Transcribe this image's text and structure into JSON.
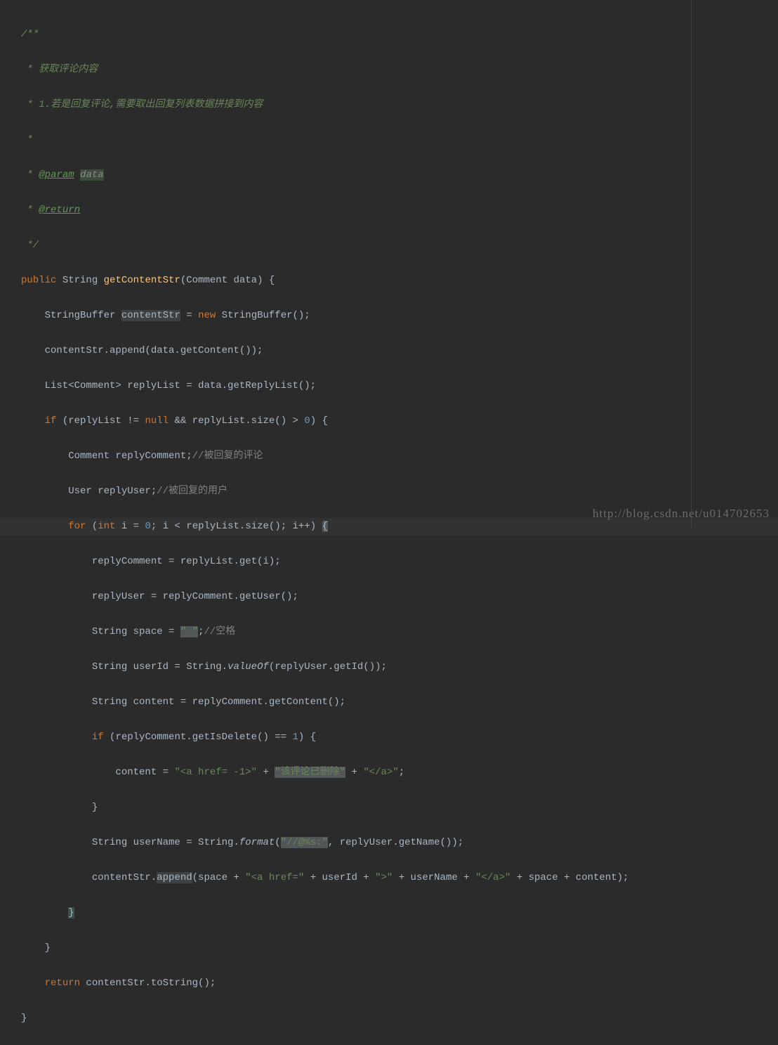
{
  "code": {
    "l1": "/**",
    "l2_pre": " * ",
    "l2_txt": "获取评论内容",
    "l3_pre": " * ",
    "l3_txt": "1.若是回复评论,需要取出回复列表数据拼接到内容",
    "l4": " *",
    "l5_pre": " * ",
    "l5_tag": "@param",
    "l5_sp": " ",
    "l5_param": "data",
    "l6_pre": " * ",
    "l6_tag": "@return",
    "l7": " */",
    "l8_kw1": "public",
    "l8_type": " String ",
    "l8_method": "getContentStr",
    "l8_rest": "(Comment data) {",
    "l9_pre": "    StringBuffer ",
    "l9_var": "contentStr",
    "l9_eq": " = ",
    "l9_new": "new",
    "l9_rest": " StringBuffer();",
    "l10": "    contentStr.append(data.getContent());",
    "l11": "    List<Comment> replyList = data.getReplyList();",
    "l12_pre": "    ",
    "l12_if": "if",
    "l12_mid1": " (replyList != ",
    "l12_null": "null",
    "l12_mid2": " && replyList.size() > ",
    "l12_num": "0",
    "l12_rest": ") {",
    "l13_pre": "        Comment replyComment;",
    "l13_cmt": "//被回复的评论",
    "l14_pre": "        User replyUser;",
    "l14_cmt": "//被回复的用户",
    "l15_pre": "        ",
    "l15_for": "for",
    "l15_mid1": " (",
    "l15_int": "int",
    "l15_mid2": " i = ",
    "l15_num": "0",
    "l15_mid3": "; i < replyList.size(); i++) ",
    "l15_brace": "{",
    "l16": "            replyComment = replyList.get(i);",
    "l17": "            replyUser = replyComment.getUser();",
    "l18_pre": "            String space = ",
    "l18_str": "\" \"",
    "l18_semi": ";",
    "l18_cmt": "//空格",
    "l19_pre": "            String userId = String.",
    "l19_method": "valueOf",
    "l19_rest": "(replyUser.getId());",
    "l20": "            String content = replyComment.getContent();",
    "l21_pre": "            ",
    "l21_if": "if",
    "l21_mid": " (replyComment.getIsDelete() == ",
    "l21_num": "1",
    "l21_rest": ") {",
    "l22_pre": "                content = ",
    "l22_s1": "\"<a href= -1>\"",
    "l22_p1": " + ",
    "l22_s2": "\"该评论已删除\"",
    "l22_p2": " + ",
    "l22_s3": "\"</a>\"",
    "l22_semi": ";",
    "l23": "            }",
    "l24_pre": "            String userName = String.",
    "l24_method": "format",
    "l24_op": "(",
    "l24_s1": "\"//@%s:\"",
    "l24_rest": ", replyUser.getName());",
    "l25_pre": "            contentStr.",
    "l25_method": "append",
    "l25_mid1": "(space + ",
    "l25_s1": "\"<a href=\"",
    "l25_mid2": " + userId + ",
    "l25_s2": "\">\"",
    "l25_mid3": " + userName + ",
    "l25_s3": "\"</a>\"",
    "l25_mid4": " + space + content);",
    "l26_pre": "        ",
    "l26_brace": "}",
    "l27": "    }",
    "l28_pre": "    ",
    "l28_ret": "return",
    "l28_rest": " contentStr.toString();",
    "l29": "}"
  },
  "watermark": "http://blog.csdn.net/u014702653"
}
